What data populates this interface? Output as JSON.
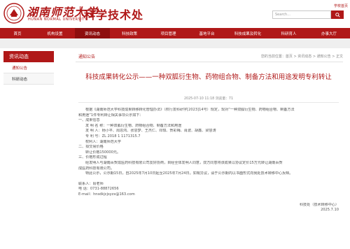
{
  "header": {
    "logo_cn": "湖南师范大学",
    "logo_en": "HUNAN NORMAL UNIVERSITY",
    "site_title": "科学技术处",
    "top_link": "学校首页",
    "search_placeholder": "Search..."
  },
  "nav": {
    "items": [
      {
        "label": "首页"
      },
      {
        "label": "机构设置"
      },
      {
        "label": "资讯动态"
      },
      {
        "label": "科技政策"
      },
      {
        "label": "项目管理"
      },
      {
        "label": "基地平台"
      },
      {
        "label": "科技成果及转化"
      },
      {
        "label": "科研育人"
      },
      {
        "label": "办事大厅"
      }
    ],
    "active_index": 2
  },
  "sidebar": {
    "heading": "资讯动态",
    "items": [
      {
        "label": "通知公告"
      },
      {
        "label": "科研动态"
      }
    ]
  },
  "breadcrumb": {
    "section_title": "通知公告",
    "path": "您的当前位置：首页 > 资讯动态 > 通知公告 > 正文"
  },
  "article": {
    "title": "科技成果转化公示——一种双胍衍生物、药物组合物、制备方法和用途发明专利转让",
    "meta": "2025-07-10 11:18   浏览量：71",
    "lines": [
      "根据《湖南师范大学科技成果转移转化管理办法》（校行发科研字[2023]14号）规定，现对“一种双胍衍生物、药物组合物、制备方法",
      "和用途”1件专利转让相关事项公示如下：",
      "一、成果信息",
      "发 明 名 称：一种双胍衍生物、药物组合物、制备方法和用途",
      "发 明 人：杨小平、周思鸿、张思梦、王杰仁、邓琪、贺彩梅、肖波、胡鑫、梁慧涛",
      "专 利 号：ZL 2018 1 1171315.7",
      "权利人：湖南师范大学",
      "二、拟交易价格",
      "转让价格150000元。",
      "三、价格形成过程",
      "经发明人与湖南百贺成医药科技有限公司友好协商，目经全体发明人同意，双方同意将该成果以协议定价15万元转让湖南百贺",
      "成医药科技有限公司。",
      "特此公示，公示期15日，自2025年7月10日起至2025年7月24日。如有异议，请于公示期内以书面形式向我处技术转移中心反映。",
      "联系人：肖老师",
      "电 话：0731-88872656",
      "E-mail：hnsdkjcjsyzx@163.com",
      "科技处（技术转移中心）",
      "2025.7.10"
    ]
  },
  "colors": {
    "brand": "#b01818",
    "nav_active": "#8e0f0f"
  },
  "icons": {
    "search": "search-icon",
    "logo": "university-seal-icon"
  }
}
